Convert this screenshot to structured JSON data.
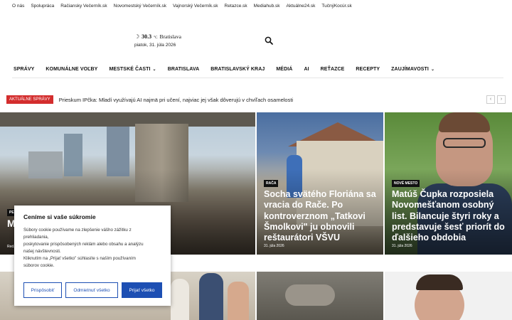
{
  "top_links": [
    "O nás",
    "Spolupráca",
    "Račiansky Večerník.sk",
    "Novomestský Večerník.sk",
    "Vajnorský Večerník.sk",
    "Retazce.sk",
    "Mediahub.sk",
    "Aktuálne24.sk",
    "TučnýKocúr.sk"
  ],
  "weather": {
    "temp": "30.3",
    "unit": "C",
    "city": "Bratislava",
    "date": "piatok, 31. júla 2026"
  },
  "nav": [
    {
      "label": "SPRÁVY"
    },
    {
      "label": "KOMUNÁLNE VOĽBY"
    },
    {
      "label": "MESTSKÉ ČASTI",
      "dropdown": true
    },
    {
      "label": "BRATISLAVA"
    },
    {
      "label": "BRATISLAVSKÝ KRAJ"
    },
    {
      "label": "MÉDIÁ"
    },
    {
      "label": "AI"
    },
    {
      "label": "REŤAZCE"
    },
    {
      "label": "RECEPTY"
    },
    {
      "label": "ZAUJÍMAVOSTI",
      "dropdown": true
    }
  ],
  "ticker": {
    "badge": "AKTUÁLNE SPRÁVY",
    "text": "Prieskum IPčka: Mladí využívajú AI najmä pri učení, najviac jej však dôverujú v chvíľach osamelosti"
  },
  "articles": {
    "main": {
      "category": "PE",
      "title": "M... súčasne cvičilo jó... cenia",
      "date": "Red..."
    },
    "race": {
      "category": "RAČA",
      "title": "Socha svätého Floriána sa vracia do Rače. Po kontroverznom „Tatkovi Šmolkovi\" ju obnovili reštaurátori VŠVU",
      "date": "31. júla 2026"
    },
    "mesto": {
      "category": "NOVÉ MESTO",
      "title": "Matúš Čupka rozposiela Novomešťanom osobný list. Bilancuje štyri roky a predstavuje šesť priorít do ďalšieho obdobia",
      "date": "31. júla 2026"
    }
  },
  "cookie": {
    "heading": "Ceníme si vaše súkromie",
    "body_lines": [
      "Súbory cookie používame na zlepšenie vášho zážitku z",
      "prehliadania,",
      "poskytovanie prispôsobených reklám alebo obsahu a analýzu",
      "našej návštevnosti.",
      "Kliknutím na „Prijať všetko\" súhlasíte s naším používaním",
      "súborov cookie."
    ],
    "btn_customize": "Prispôsobiť",
    "btn_reject": "Odmietnuť všetko",
    "btn_accept": "Prijať všetko"
  }
}
